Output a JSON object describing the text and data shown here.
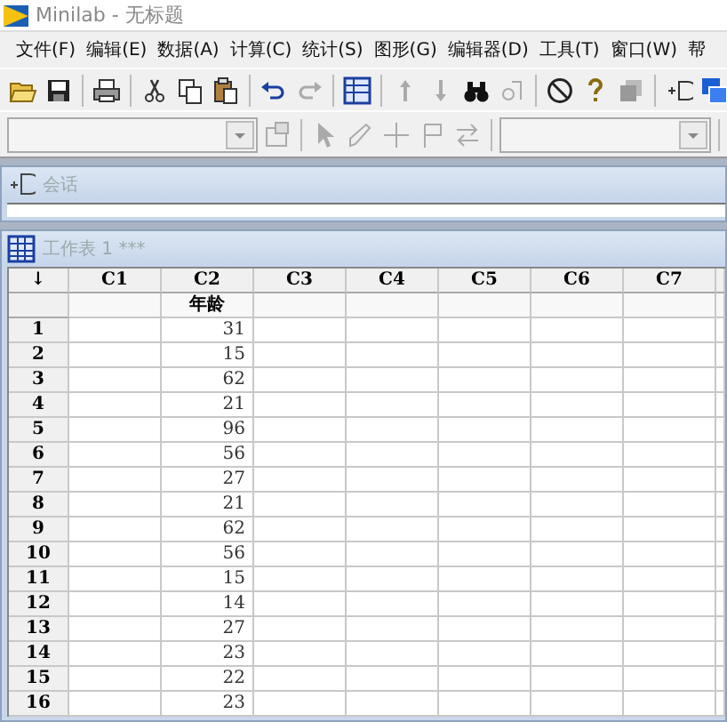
{
  "window": {
    "title": "Minilab - 无标题"
  },
  "menu": [
    {
      "label": "文件(F)"
    },
    {
      "label": "编辑(E)"
    },
    {
      "label": "数据(A)"
    },
    {
      "label": "计算(C)"
    },
    {
      "label": "统计(S)"
    },
    {
      "label": "图形(G)"
    },
    {
      "label": "编辑器(D)"
    },
    {
      "label": "工具(T)"
    },
    {
      "label": "窗口(W)"
    },
    {
      "label": "帮"
    }
  ],
  "session_window": {
    "title": "会话"
  },
  "worksheet": {
    "title": "工作表 1 ***",
    "corner": "↓",
    "columns": [
      {
        "label": "C1"
      },
      {
        "label": "C2",
        "name": "年龄"
      },
      {
        "label": "C3"
      },
      {
        "label": "C4"
      },
      {
        "label": "C5"
      },
      {
        "label": "C6"
      },
      {
        "label": "C7"
      }
    ],
    "rows": [
      {
        "number": "1",
        "c2": "31"
      },
      {
        "number": "2",
        "c2": "15"
      },
      {
        "number": "3",
        "c2": "62"
      },
      {
        "number": "4",
        "c2": "21"
      },
      {
        "number": "5",
        "c2": "96"
      },
      {
        "number": "6",
        "c2": "56"
      },
      {
        "number": "7",
        "c2": "27"
      },
      {
        "number": "8",
        "c2": "21"
      },
      {
        "number": "9",
        "c2": "62"
      },
      {
        "number": "10",
        "c2": "56"
      },
      {
        "number": "11",
        "c2": "15"
      },
      {
        "number": "12",
        "c2": "14"
      },
      {
        "number": "13",
        "c2": "27"
      },
      {
        "number": "14",
        "c2": "23"
      },
      {
        "number": "15",
        "c2": "22"
      },
      {
        "number": "16",
        "c2": "23"
      }
    ]
  }
}
